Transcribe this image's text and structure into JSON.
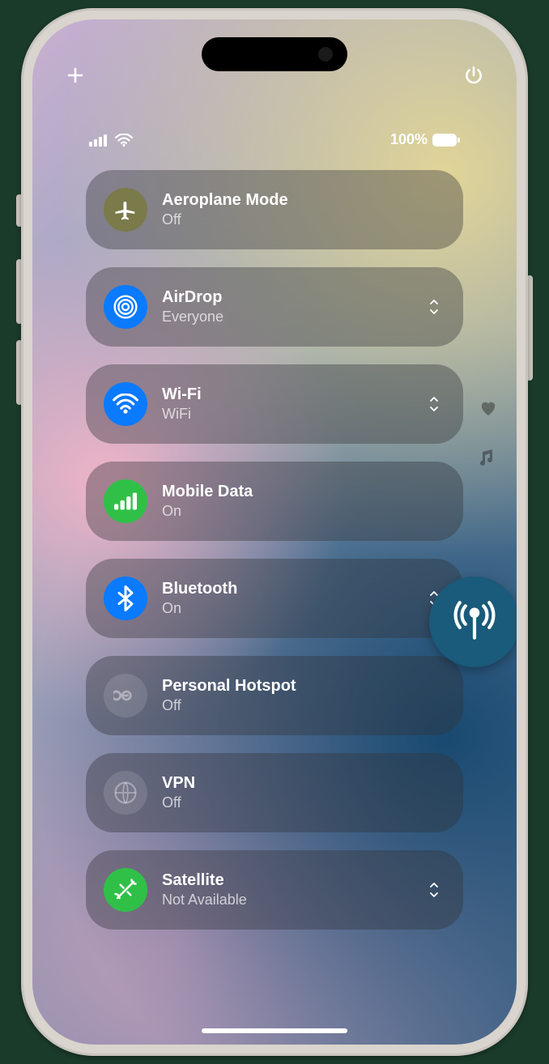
{
  "status": {
    "battery": "100%"
  },
  "tiles": [
    {
      "id": "aeroplane",
      "title": "Aeroplane Mode",
      "sub": "Off",
      "icon": "airplane-icon",
      "color": "olive",
      "chevron": false
    },
    {
      "id": "airdrop",
      "title": "AirDrop",
      "sub": "Everyone",
      "icon": "airdrop-icon",
      "color": "blue",
      "chevron": true
    },
    {
      "id": "wifi",
      "title": "Wi-Fi",
      "sub": "WiFi",
      "icon": "wifi-icon",
      "color": "blue",
      "chevron": true
    },
    {
      "id": "mobile-data",
      "title": "Mobile Data",
      "sub": "On",
      "icon": "cellular-icon",
      "color": "green",
      "chevron": false
    },
    {
      "id": "bluetooth",
      "title": "Bluetooth",
      "sub": "On",
      "icon": "bluetooth-icon",
      "color": "blue",
      "chevron": true
    },
    {
      "id": "hotspot",
      "title": "Personal Hotspot",
      "sub": "Off",
      "icon": "hotspot-icon",
      "color": "dim",
      "chevron": false
    },
    {
      "id": "vpn",
      "title": "VPN",
      "sub": "Off",
      "icon": "vpn-icon",
      "color": "dim",
      "chevron": false
    },
    {
      "id": "satellite",
      "title": "Satellite",
      "sub": "Not Available",
      "icon": "satellite-icon",
      "color": "green",
      "chevron": true
    }
  ]
}
